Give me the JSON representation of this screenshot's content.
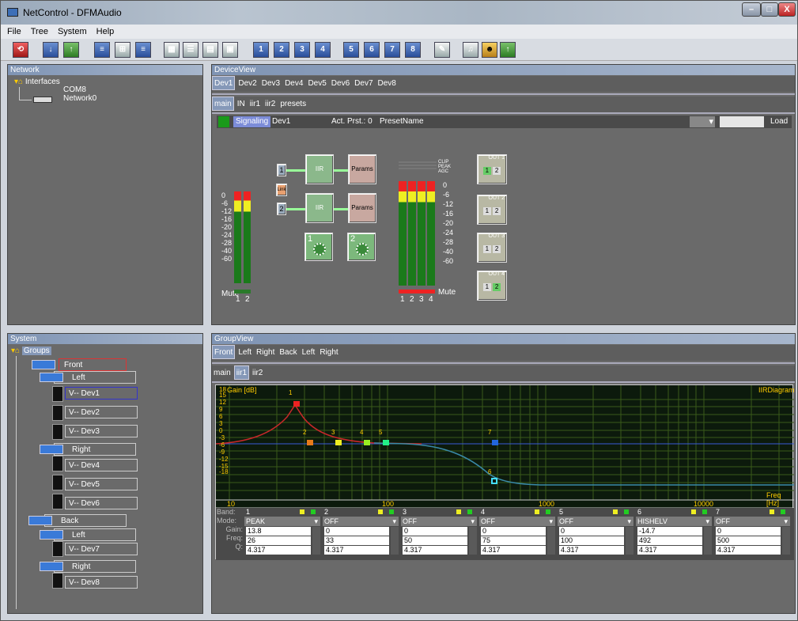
{
  "window": {
    "title": "NetControl - DFMAudio",
    "min": "–",
    "max": "□",
    "close": "X"
  },
  "menu": [
    "File",
    "Tree",
    "System",
    "Help"
  ],
  "network": {
    "title": "Network",
    "root": "Interfaces",
    "items": [
      "COM8",
      "Network0"
    ]
  },
  "device": {
    "title": "DeviceView",
    "tabs": [
      "Dev1",
      "Dev2",
      "Dev3",
      "Dev4",
      "Dev5",
      "Dev6",
      "Dev7",
      "Dev8"
    ],
    "subtabs": [
      "main",
      "IN",
      "iir1",
      "iir2",
      "presets"
    ],
    "signaling": "Signaling",
    "dev": "Dev1",
    "act_prst": "Act. Prst.: 0",
    "preset_name": "PresetName",
    "load": "Load",
    "iir": "IIR",
    "params": "Params",
    "link": "Link",
    "in1": "1",
    "in2": "2",
    "knob1": "1",
    "knob2": "2",
    "mute": "Mute",
    "in_scale": [
      "0",
      "-6",
      "-12",
      "-16",
      "-20",
      "-24",
      "-28",
      "-40",
      "-60"
    ],
    "out_scale": [
      "0",
      "-6",
      "-12",
      "-16",
      "-20",
      "-24",
      "-28",
      "-40",
      "-60"
    ],
    "in_ch": [
      "1",
      "2"
    ],
    "out_ch": [
      "1",
      "2",
      "3",
      "4"
    ],
    "out_labels": [
      "CLIP",
      "PEAK",
      "AGC"
    ],
    "outs": [
      "OUT 1",
      "OUT 2",
      "OUT 3",
      "OUT 4"
    ],
    "out_btns": [
      "1",
      "2"
    ]
  },
  "system": {
    "title": "System",
    "root": "Groups",
    "front": "Front",
    "back": "Back",
    "left": "Left",
    "right": "Right",
    "devs": [
      "V-- Dev1",
      "V-- Dev2",
      "V-- Dev3",
      "V-- Dev4",
      "V-- Dev5",
      "V-- Dev6",
      "V-- Dev7",
      "V-- Dev8"
    ]
  },
  "group": {
    "title": "GroupView",
    "tabs": [
      "Front",
      "Left",
      "Right",
      "Back",
      "Left",
      "Right"
    ],
    "subtabs": [
      "main",
      "iir1",
      "iir2"
    ]
  },
  "diagram": {
    "title": "IIRDiagram",
    "ylabel": "Gain [dB]",
    "xlabel": "Freq [Hz]",
    "yticks": [
      "18",
      "15",
      "12",
      "9",
      "6",
      "3",
      "0",
      "-3",
      "-6",
      "-9",
      "-12",
      "-15",
      "-18"
    ],
    "xticks": [
      "10",
      "100",
      "1000",
      "10000"
    ],
    "markers": [
      "1",
      "2",
      "3",
      "4",
      "5",
      "6",
      "7"
    ]
  },
  "bands": {
    "labels": [
      "Band:",
      "Mode:",
      "Gain:",
      "Freq:",
      "Q:"
    ],
    "list": [
      {
        "n": "1",
        "mode": "PEAK",
        "gain": "13.8",
        "freq": "26",
        "q": "4.317"
      },
      {
        "n": "2",
        "mode": "OFF",
        "gain": "0",
        "freq": "33",
        "q": "4.317"
      },
      {
        "n": "3",
        "mode": "OFF",
        "gain": "0",
        "freq": "50",
        "q": "4.317"
      },
      {
        "n": "4",
        "mode": "OFF",
        "gain": "0",
        "freq": "75",
        "q": "4.317"
      },
      {
        "n": "5",
        "mode": "OFF",
        "gain": "0",
        "freq": "100",
        "q": "4.317"
      },
      {
        "n": "6",
        "mode": "HISHELV",
        "gain": "-14.7",
        "freq": "492",
        "q": "4.317"
      },
      {
        "n": "7",
        "mode": "OFF",
        "gain": "0",
        "freq": "500",
        "q": "4.317"
      }
    ]
  }
}
